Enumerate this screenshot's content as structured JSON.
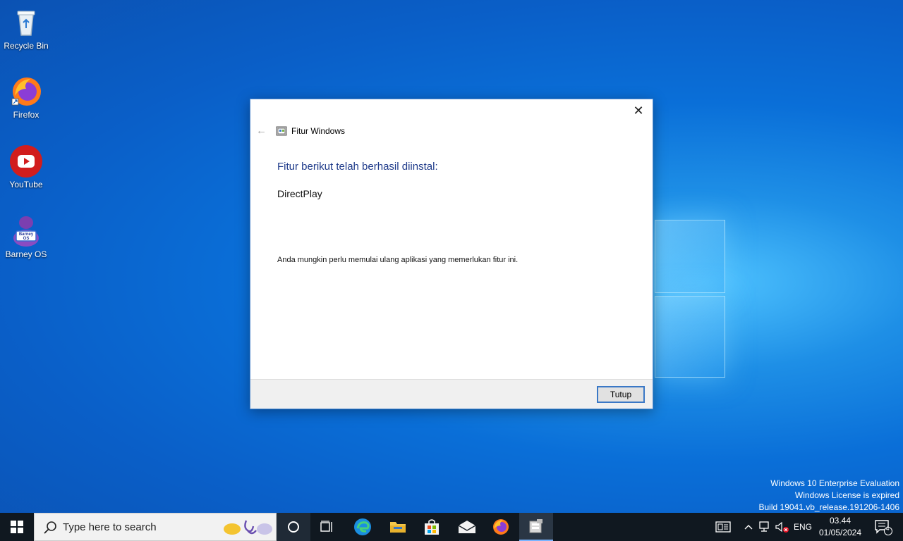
{
  "desktop": {
    "icons": [
      {
        "label": "Recycle Bin",
        "icon": "recycle-bin-icon"
      },
      {
        "label": "Firefox",
        "icon": "firefox-icon"
      },
      {
        "label": "YouTube",
        "icon": "youtube-icon"
      },
      {
        "label": "Barney OS",
        "icon": "barney-os-icon"
      }
    ],
    "barney_badge": "Barney OS"
  },
  "dialog": {
    "title": "Fitur Windows",
    "heading": "Fitur berikut telah berhasil diinstal:",
    "feature": "DirectPlay",
    "note": "Anda mungkin perlu memulai ulang aplikasi yang memerlukan fitur ini.",
    "close_button": "Tutup",
    "close_glyph": "✕",
    "back_glyph": "←"
  },
  "watermark": {
    "line1": "Windows 10 Enterprise Evaluation",
    "line2": "Windows License is expired",
    "line3": "Build 19041.vb_release.191206-1406"
  },
  "taskbar": {
    "search_placeholder": "Type here to search",
    "language": "ENG",
    "time": "03.44",
    "date": "01/05/2024",
    "notification_count": "4",
    "colors": {
      "bar": "#101820",
      "accent": "#3a78c6"
    }
  }
}
